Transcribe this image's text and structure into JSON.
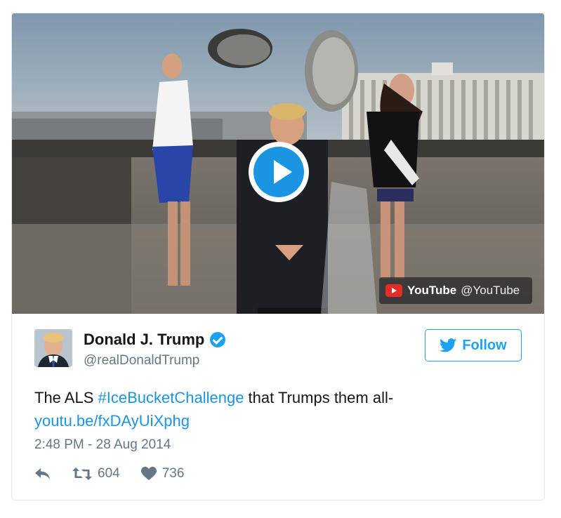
{
  "video": {
    "provider_name": "YouTube",
    "provider_handle": "@YouTube",
    "play_icon": "play-icon",
    "provider_icon": "youtube-logo-icon"
  },
  "author": {
    "display_name": "Donald J. Trump",
    "handle": "@realDonaldTrump",
    "verified_icon": "verified-badge-icon",
    "avatar_icon": "avatar"
  },
  "follow": {
    "label": "Follow",
    "icon": "twitter-bird-icon"
  },
  "tweet": {
    "text_prefix": "The ALS ",
    "hashtag": "#IceBucketChallenge",
    "text_suffix": " that Trumps them all-",
    "link": "youtu.be/fxDAyUiXphg",
    "timestamp": "2:48 PM - 28 Aug 2014"
  },
  "actions": {
    "reply_icon": "reply-icon",
    "retweet_icon": "retweet-icon",
    "retweet_count": "604",
    "like_icon": "heart-icon",
    "like_count": "736"
  },
  "colors": {
    "accent": "#1da1f2",
    "link": "#1b95e0",
    "muted": "#657786",
    "youtube_red": "#e52d27"
  }
}
